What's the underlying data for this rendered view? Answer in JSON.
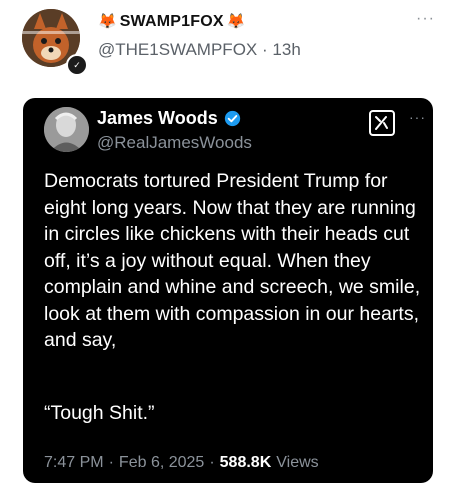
{
  "post": {
    "display_name": "SWAMP1FOX",
    "name_prefix_emoji": "🦊",
    "name_suffix_emoji": "🦊",
    "handle": "@THE1SWAMPFOX",
    "separator": "·",
    "time": "13h",
    "more": "···",
    "avatar_icon": "fox-avatar",
    "badge_icon": "check-badge-icon"
  },
  "quoted": {
    "name": "James Woods",
    "handle": "@RealJamesWoods",
    "grok_icon": "grok-icon",
    "more": "···",
    "text": "Democrats tortured President Trump for eight long years. Now that they are running in circles like chickens with their heads cut off, it’s a joy without equal. When they complain and whine and screech, we smile, look at them with compassion in our hearts, and say,",
    "quote": "“Tough Shit.”",
    "time": "7:47 PM",
    "sep1": "·",
    "date": "Feb 6, 2025",
    "sep2": "·",
    "views_count": "588.8K",
    "views_label": "Views",
    "colors": {
      "background": "#000000",
      "verified": "#1d9bf0",
      "muted": "#8b929a"
    }
  }
}
